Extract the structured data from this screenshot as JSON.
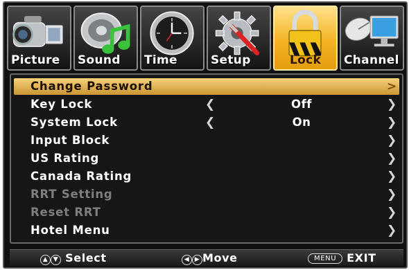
{
  "tabs": [
    {
      "label": "Picture",
      "icon": "camcorder-icon"
    },
    {
      "label": "Sound",
      "icon": "speaker-music-icon"
    },
    {
      "label": "Time",
      "icon": "clock-icon"
    },
    {
      "label": "Setup",
      "icon": "gear-wrench-icon"
    },
    {
      "label": "Lock",
      "icon": "padlock-icon",
      "active": true
    },
    {
      "label": "Channel",
      "icon": "satellite-monitor-icon"
    }
  ],
  "menu": {
    "items": [
      {
        "label": "Change Password",
        "selected": true
      },
      {
        "label": "Key Lock",
        "value": "Off"
      },
      {
        "label": "System Lock",
        "value": "On"
      },
      {
        "label": "Input Block"
      },
      {
        "label": "US Rating"
      },
      {
        "label": "Canada Rating"
      },
      {
        "label": "RRT Setting",
        "disabled": true
      },
      {
        "label": "Reset RRT",
        "disabled": true
      },
      {
        "label": "Hotel Menu"
      }
    ]
  },
  "footer": {
    "select_label": "Select",
    "move_label": "Move",
    "menu_key": "MENU",
    "exit_label": "EXIT"
  },
  "colors": {
    "active_tab": "#f4b324",
    "highlight": "#e8bb5a",
    "disabled_text": "#7f7f7f"
  }
}
